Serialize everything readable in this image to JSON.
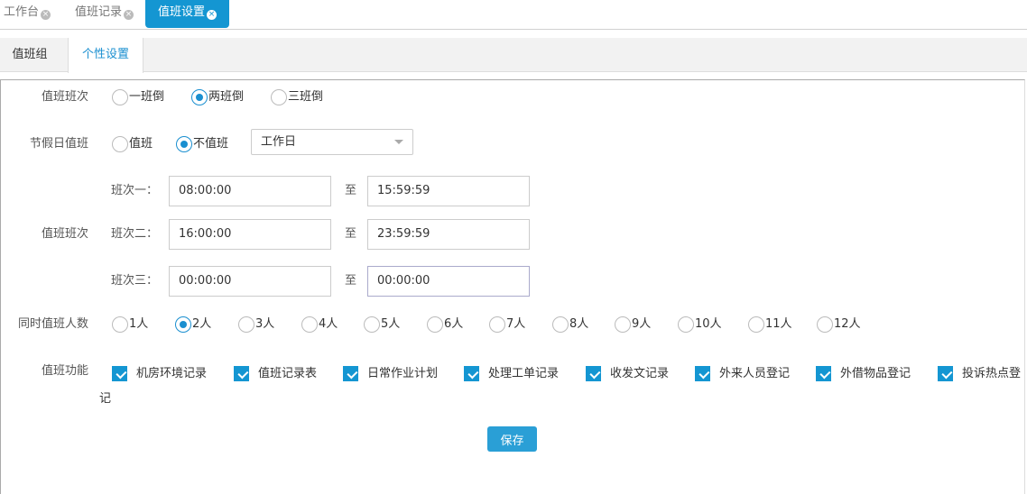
{
  "top_tabs": [
    {
      "label": "工作台"
    },
    {
      "label": "值班记录"
    },
    {
      "label": "值班设置",
      "active": true
    }
  ],
  "sub_tabs": [
    {
      "label": "值班组"
    },
    {
      "label": "个性设置",
      "active": true
    }
  ],
  "form": {
    "shift_mode": {
      "label": "值班班次",
      "options": [
        "一班倒",
        "两班倒",
        "三班倒"
      ],
      "selected": "两班倒"
    },
    "holiday": {
      "label": "节假日值班",
      "options": [
        "值班",
        "不值班"
      ],
      "selected": "不值班",
      "select_value": "工作日"
    },
    "shifts": {
      "label": "值班班次",
      "to": "至",
      "rows": [
        {
          "name": "班次一：",
          "start": "08:00:00",
          "end": "15:59:59"
        },
        {
          "name": "班次二：",
          "start": "16:00:00",
          "end": "23:59:59"
        },
        {
          "name": "班次三：",
          "start": "00:00:00",
          "end": "00:00:00"
        }
      ]
    },
    "people": {
      "label": "同时值班人数",
      "options": [
        "1人",
        "2人",
        "3人",
        "4人",
        "5人",
        "6人",
        "7人",
        "8人",
        "9人",
        "10人",
        "11人",
        "12人"
      ],
      "selected": "2人"
    },
    "functions": {
      "label": "值班功能",
      "items": [
        {
          "label": "机房环境记录",
          "checked": true
        },
        {
          "label": "值班记录表",
          "checked": true
        },
        {
          "label": "日常作业计划",
          "checked": true
        },
        {
          "label": "处理工单记录",
          "checked": true
        },
        {
          "label": "收发文记录",
          "checked": true
        },
        {
          "label": "外来人员登记",
          "checked": true
        },
        {
          "label": "外借物品登记",
          "checked": true
        },
        {
          "label": "投诉热点登",
          "checked": true
        }
      ],
      "wrap_text": "记"
    },
    "save_label": "保存"
  },
  "colors": {
    "accent": "#1496d2"
  }
}
